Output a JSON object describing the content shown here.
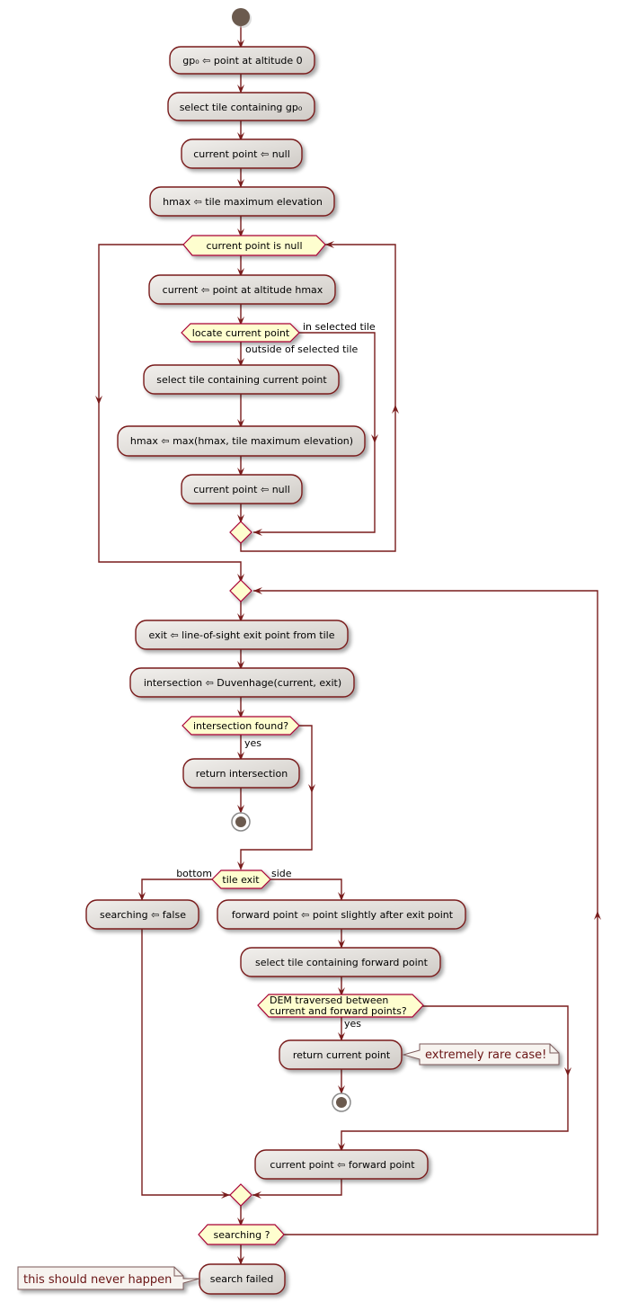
{
  "diagram": {
    "type": "activity",
    "activities": {
      "a1": "gp₀ ⇦ point at altitude 0",
      "a2": "select tile containing gp₀",
      "a3": "current point ⇦ null",
      "a4": "hmax ⇦ tile maximum elevation",
      "a5": "current ⇦ point at altitude hmax",
      "a6": "select tile containing current point",
      "a7": "hmax ⇦ max(hmax, tile maximum elevation)",
      "a8": "current point ⇦ null",
      "a9": "exit ⇦ line-of-sight exit point from tile",
      "a10": "intersection ⇦ Duvenhage(current, exit)",
      "a11": "return intersection",
      "a12": "searching ⇦ false",
      "a13": "forward point ⇦ point slightly after exit point",
      "a14": "select tile containing forward point",
      "a15": "return current point",
      "a16": "current point ⇦ forward point",
      "a17": "search failed"
    },
    "decisions": {
      "d1": "current point is null",
      "d2": "locate current point",
      "d3": "intersection found?",
      "d4": "tile exit",
      "d5_line1": "DEM traversed between",
      "d5_line2": "current and forward points?",
      "d6": "searching ?"
    },
    "edge_labels": {
      "in_selected_tile": "in selected tile",
      "outside_selected_tile": "outside of selected tile",
      "yes1": "yes",
      "bottom": "bottom",
      "side": "side",
      "yes2": "yes"
    },
    "notes": {
      "n1": "extremely rare case!",
      "n2": "this should never happen"
    },
    "colors": {
      "line": "#791c1c",
      "decision_fill": "#fefecf",
      "decision_border": "#a80036",
      "node_fill_start": "#f1efec",
      "node_fill_end": "#cfcbc6",
      "start_node": "#6b5a4e"
    }
  }
}
